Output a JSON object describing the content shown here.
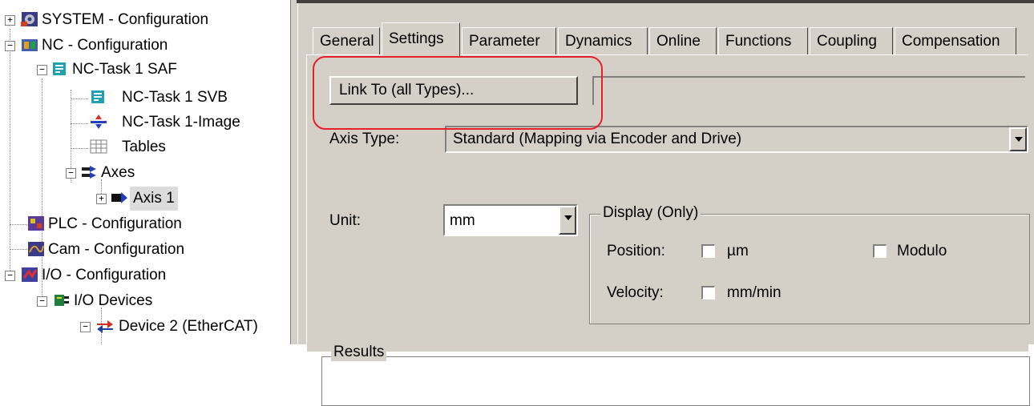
{
  "tree": {
    "items": [
      {
        "label": "SYSTEM - Configuration",
        "icon": "system-config-icon",
        "expander": "+"
      },
      {
        "label": "NC - Configuration",
        "icon": "nc-config-icon",
        "expander": "−"
      },
      {
        "label": "NC-Task 1 SAF",
        "icon": "task-icon",
        "expander": "−"
      },
      {
        "label": "NC-Task 1 SVB",
        "icon": "task-icon"
      },
      {
        "label": "NC-Task 1-Image",
        "icon": "image-icon"
      },
      {
        "label": "Tables",
        "icon": "table-icon"
      },
      {
        "label": "Axes",
        "icon": "axes-icon",
        "expander": "−"
      },
      {
        "label": "Axis 1",
        "icon": "axis-icon",
        "expander": "+"
      },
      {
        "label": "PLC - Configuration",
        "icon": "plc-config-icon"
      },
      {
        "label": "Cam - Configuration",
        "icon": "cam-config-icon"
      },
      {
        "label": "I/O - Configuration",
        "icon": "io-config-icon",
        "expander": "−"
      },
      {
        "label": "I/O Devices",
        "icon": "io-devices-icon",
        "expander": "−"
      },
      {
        "label": "Device 2 (EtherCAT)",
        "icon": "ethercat-device-icon",
        "expander": "−"
      }
    ]
  },
  "tabs": [
    "General",
    "Settings",
    "Parameter",
    "Dynamics",
    "Online",
    "Functions",
    "Coupling",
    "Compensation"
  ],
  "active_tab": "Settings",
  "settings": {
    "link_button_label": "Link To (all Types)...",
    "link_value": "",
    "axis_type_label": "Axis Type:",
    "axis_type_value": "Standard (Mapping via Encoder and Drive)",
    "unit_label": "Unit:",
    "unit_value": "mm",
    "display_group_title": "Display (Only)",
    "position_label": "Position:",
    "position_unit": "µm",
    "modulo_label": "Modulo",
    "velocity_label": "Velocity:",
    "velocity_unit": "mm/min",
    "results_label": "Results"
  },
  "colors": {
    "highlight": "#e8202a",
    "dialog_bg": "#d4d0c8"
  }
}
